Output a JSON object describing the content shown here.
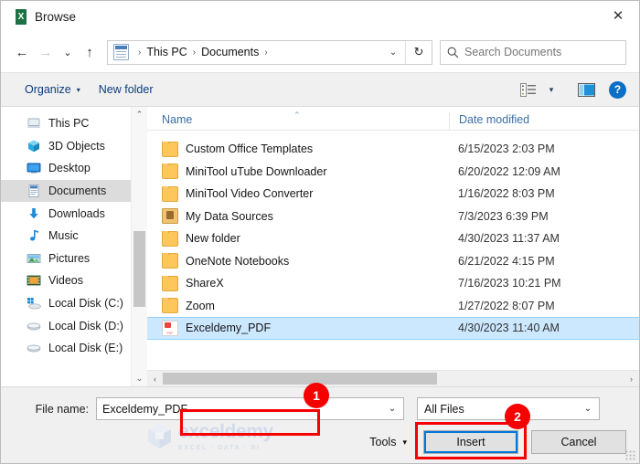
{
  "window": {
    "title": "Browse",
    "app_icon": "excel-icon",
    "close_label": "✕"
  },
  "nav": {
    "back": "←",
    "forward": "→",
    "recent": "⌄",
    "up": "↑",
    "refresh": "↻",
    "address_icon": "documents-folder-icon",
    "breadcrumbs": [
      "This PC",
      "Documents"
    ],
    "breadcrumb_separator": "›",
    "address_dropdown": "⌄"
  },
  "search": {
    "placeholder": "Search Documents",
    "value": "",
    "icon": "search-icon"
  },
  "commandbar": {
    "organize_label": "Organize",
    "organize_caret": "▾",
    "new_folder_label": "New folder",
    "view_options_icon": "view-options-icon",
    "view_caret": "▾",
    "preview_pane_icon": "preview-pane-icon",
    "help_label": "?"
  },
  "sidebar": {
    "items": [
      {
        "label": "This PC",
        "icon": "this-pc-icon",
        "selected": false
      },
      {
        "label": "3D Objects",
        "icon": "3d-objects-icon",
        "selected": false
      },
      {
        "label": "Desktop",
        "icon": "desktop-icon",
        "selected": false
      },
      {
        "label": "Documents",
        "icon": "documents-icon",
        "selected": true
      },
      {
        "label": "Downloads",
        "icon": "downloads-icon",
        "selected": false
      },
      {
        "label": "Music",
        "icon": "music-icon",
        "selected": false
      },
      {
        "label": "Pictures",
        "icon": "pictures-icon",
        "selected": false
      },
      {
        "label": "Videos",
        "icon": "videos-icon",
        "selected": false
      },
      {
        "label": "Local Disk (C:)",
        "icon": "windows-disk-icon",
        "selected": false
      },
      {
        "label": "Local Disk (D:)",
        "icon": "disk-icon",
        "selected": false
      },
      {
        "label": "Local Disk (E:)",
        "icon": "disk-icon",
        "selected": false
      }
    ],
    "scroll_up": "⌃",
    "scroll_down": "⌄"
  },
  "filelist": {
    "columns": {
      "name": "Name",
      "date_modified": "Date modified"
    },
    "sort_indicator": "⌃",
    "rows": [
      {
        "name": "Custom Office Templates",
        "date": "6/15/2023 2:03 PM",
        "icon": "folder-icon",
        "selected": false
      },
      {
        "name": "MiniTool uTube Downloader",
        "date": "6/20/2022 12:09 AM",
        "icon": "folder-icon",
        "selected": false
      },
      {
        "name": "MiniTool Video Converter",
        "date": "1/16/2022 8:03 PM",
        "icon": "folder-icon",
        "selected": false
      },
      {
        "name": "My Data Sources",
        "date": "7/3/2023 6:39 PM",
        "icon": "data-source-folder-icon",
        "selected": false
      },
      {
        "name": "New folder",
        "date": "4/30/2023 11:37 AM",
        "icon": "folder-icon",
        "selected": false
      },
      {
        "name": "OneNote Notebooks",
        "date": "6/21/2022 4:15 PM",
        "icon": "folder-icon",
        "selected": false
      },
      {
        "name": "ShareX",
        "date": "7/16/2023 10:21 PM",
        "icon": "folder-icon",
        "selected": false
      },
      {
        "name": "Zoom",
        "date": "1/27/2022 8:07 PM",
        "icon": "folder-icon",
        "selected": false
      },
      {
        "name": "Exceldemy_PDF",
        "date": "4/30/2023 11:40 AM",
        "icon": "pdf-icon",
        "selected": true
      }
    ],
    "hscroll_left": "‹",
    "hscroll_right": "›"
  },
  "footer": {
    "filename_label": "File name:",
    "filename_value": "Exceldemy_PDF",
    "filename_placeholder": "",
    "filename_dropdown": "⌄",
    "filetype_value": "All Files",
    "filetype_dropdown": "⌄",
    "tools_label": "Tools",
    "tools_caret": "▾",
    "insert_label": "Insert",
    "cancel_label": "Cancel"
  },
  "watermark": {
    "main": "exceldemy",
    "sub": "EXCEL · DATA · BI"
  },
  "annotations": {
    "badges": [
      "1",
      "2"
    ],
    "color": "#f60000"
  }
}
